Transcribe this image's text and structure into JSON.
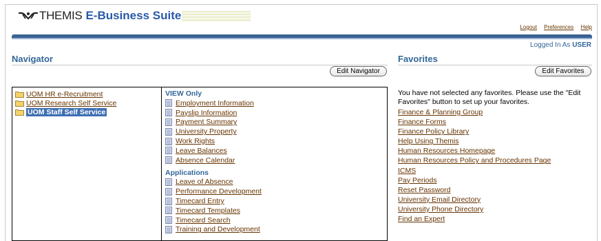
{
  "header": {
    "brand_name": "THEMIS",
    "brand_suite": "E-Business Suite",
    "links": [
      "Logout",
      "Preferences",
      "Help"
    ],
    "logged_in_prefix": "Logged In As",
    "logged_in_user": "USER"
  },
  "navigator": {
    "title": "Navigator",
    "edit_button": "Edit Navigator",
    "responsibilities": [
      {
        "label": "UOM HR e-Recruitment",
        "selected": false
      },
      {
        "label": "UOM Research Self Service",
        "selected": false
      },
      {
        "label": "UOM Staff Self Service",
        "selected": true
      }
    ],
    "view_only_heading": "VIEW Only",
    "view_only": [
      "Employment Information",
      "Payslip Information",
      "Payment Summary",
      "University Property",
      "Work Rights",
      "Leave Balances",
      "Absence Calendar"
    ],
    "applications_heading": "Applications",
    "applications": [
      "Leave of Absence",
      "Performance Development",
      "Timecard Entry",
      "Timecard Templates",
      "Timecard Search",
      "Training and Development"
    ]
  },
  "favorites": {
    "title": "Favorites",
    "edit_button": "Edit Favorites",
    "message": "You have not selected any favorites. Please use the \"Edit Favorites\" button to set up your favorites.",
    "links": [
      "Finance & Planning Group",
      "Finance Forms",
      "Finance Policy Library",
      "Help Using Themis",
      "Human Resources Homepage",
      "Human Resources Policy and Procedures Page",
      "ICMS",
      "Pay Periods",
      "Reset Password",
      "University Email Directory",
      "University Phone Directory",
      "Find an Expert"
    ]
  },
  "colors": {
    "link": "#663300",
    "heading": "#336699",
    "brand_bar": "#3a6393",
    "selection": "#3e6fb3"
  }
}
